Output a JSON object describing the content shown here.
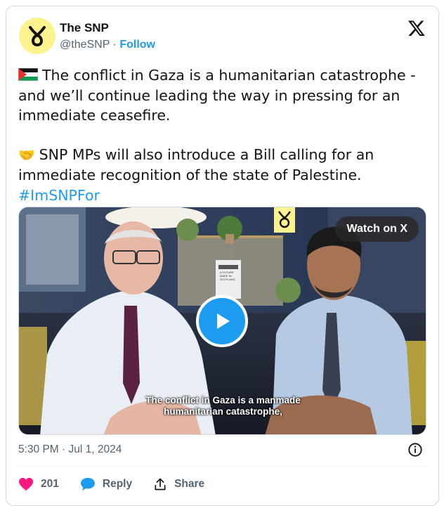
{
  "author": {
    "name": "The SNP",
    "handle": "@theSNP",
    "separator": "·",
    "follow_label": "Follow"
  },
  "tweet": {
    "paragraph1": "The conflict in Gaza is a humanitarian catastrophe - and we’ll continue leading the way in pressing for an immediate ceasefire.",
    "paragraph2": "SNP MPs will also introduce a Bill calling for an immediate recognition of the state of Palestine.",
    "hashtag": "#ImSNPFor",
    "paragraph1_icon": "palestine-flag-emoji",
    "paragraph2_icon": "handshake-emoji"
  },
  "media": {
    "watch_label": "Watch on X",
    "caption_line1": "The conflict in Gaza is a manmade",
    "caption_line2": "humanitarian catastrophe,",
    "poster_text_1": "A FUTURE",
    "poster_text_2": "MADE IN",
    "poster_text_3": "SCOTLAND"
  },
  "meta": {
    "timestamp": "5:30 PM · Jul 1, 2024"
  },
  "actions": {
    "likes_count": "201",
    "reply_label": "Reply",
    "share_label": "Share"
  },
  "colors": {
    "accent": "#1d9bf0",
    "like": "#f91880",
    "reply": "#1d9bf0",
    "avatar_bg": "#fdf38e"
  }
}
